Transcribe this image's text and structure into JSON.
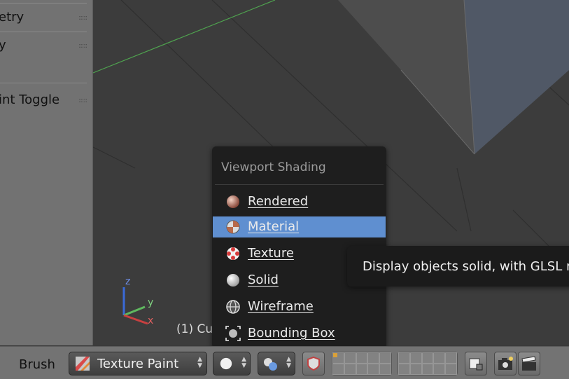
{
  "toolshelf": {
    "rows": [
      {
        "label": "etry"
      },
      {
        "label": "y"
      },
      {
        "label": "int Toggle"
      }
    ]
  },
  "viewport": {
    "object_label": "(1) Cu",
    "axis": {
      "z": "z",
      "y": "y",
      "x": "x"
    }
  },
  "menu": {
    "title": "Viewport Shading",
    "items": [
      {
        "label": "Rendered",
        "icon": "rendered-sphere-icon",
        "active": false
      },
      {
        "label": "Material",
        "icon": "material-sphere-icon",
        "active": true
      },
      {
        "label": "Texture",
        "icon": "texture-sphere-icon",
        "active": false
      },
      {
        "label": "Solid",
        "icon": "solid-sphere-icon",
        "active": false
      },
      {
        "label": "Wireframe",
        "icon": "wireframe-sphere-icon",
        "active": false
      },
      {
        "label": "Bounding Box",
        "icon": "bounding-box-icon",
        "active": false
      }
    ]
  },
  "tooltip": {
    "text": "Display objects solid, with GLSL m"
  },
  "header": {
    "brush_label": "Brush",
    "mode": "Texture Paint"
  },
  "colors": {
    "menu_highlight": "#5f8fd0",
    "viewport_bg": "#3c3c3c",
    "shelf_bg": "#727272"
  }
}
